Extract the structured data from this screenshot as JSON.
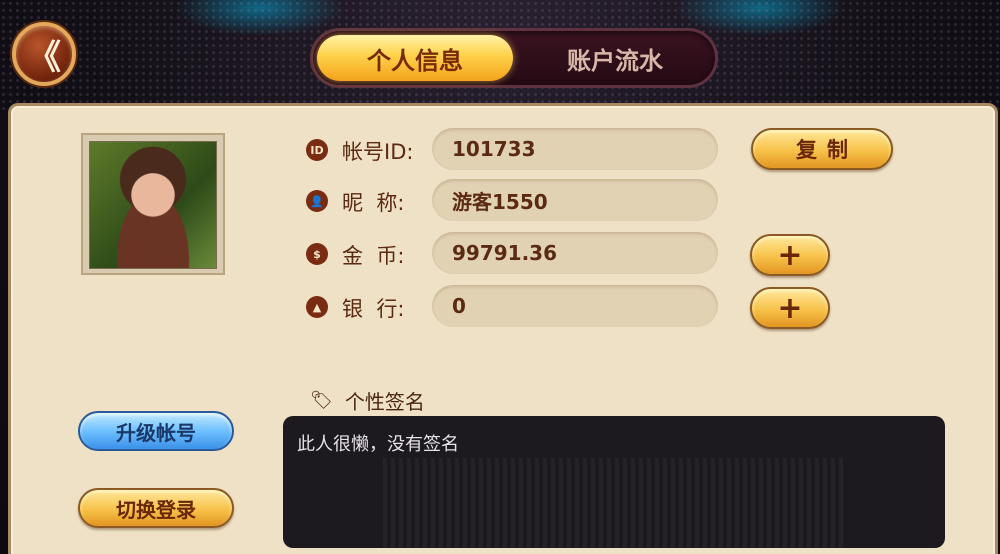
{
  "header": {
    "back_icon_glyph": "《",
    "tabs": [
      {
        "label": "个人信息",
        "active": true
      },
      {
        "label": "账户流水",
        "active": false
      }
    ]
  },
  "profile": {
    "rows": [
      {
        "icon": "ID",
        "label": "帐号ID:",
        "value": "101733"
      },
      {
        "icon": "👤",
        "label": "昵  称:",
        "value": "游客1550"
      },
      {
        "icon": "$",
        "label": "金  币:",
        "value": "99791.36"
      },
      {
        "icon": "▲",
        "label": "银  行:",
        "value": "0"
      }
    ],
    "copy_label": "复制",
    "plus_label": "+",
    "signature_label": "个性签名",
    "signature_text": "此人很懒，没有签名",
    "upgrade_label": "升级帐号",
    "switch_label": "切换登录"
  },
  "colors": {
    "panel_bg": "#efe1c6",
    "accent_brown": "#5a2a12",
    "gold": "#f7c24a",
    "blue": "#6ec0ff"
  }
}
